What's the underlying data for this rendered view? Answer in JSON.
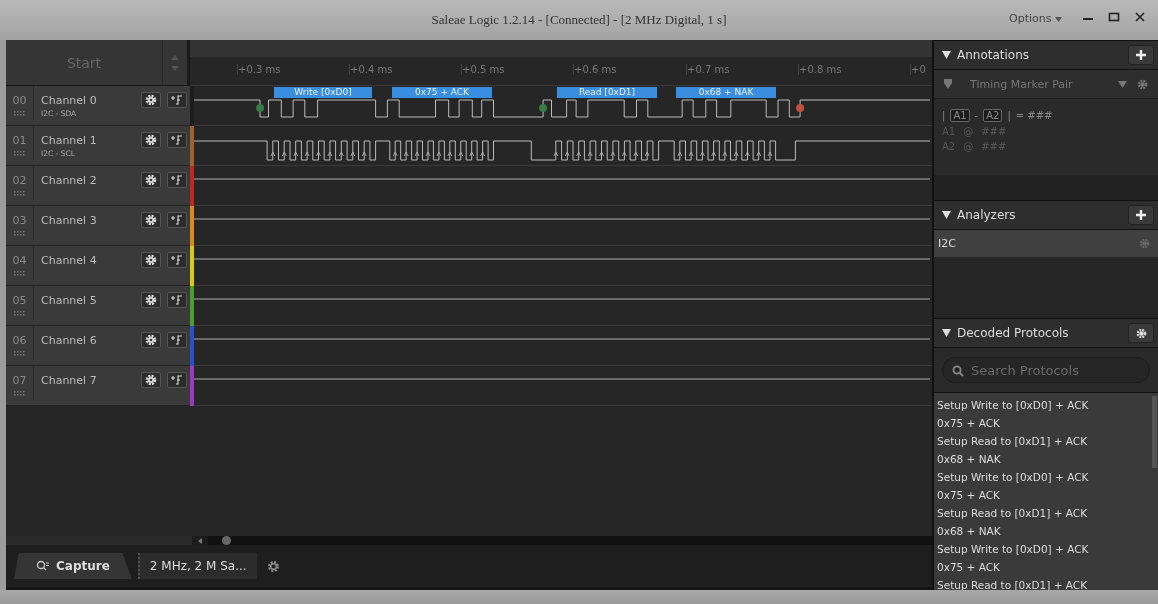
{
  "window": {
    "title": "Saleae Logic 1.2.14 - [Connected] - [2 MHz Digital, 1 s]",
    "options": "Options"
  },
  "start_button": "Start",
  "ruler": {
    "ticks": [
      "+0.3 ms",
      "+0.4 ms",
      "+0.5 ms",
      "+0.6 ms",
      "+0.7 ms",
      "+0.8 ms",
      "+0"
    ]
  },
  "channels": [
    {
      "number": "00",
      "name": "Channel 0",
      "label": "I2C - SDA",
      "color": "#1c1c1c",
      "kind": "sda",
      "decodes": [
        "Write [0xD0]",
        "0x75 + ACK",
        "Read [0xD1]",
        "0x68 + NAK"
      ]
    },
    {
      "number": "01",
      "name": "Channel 1",
      "label": "I2C - SCL",
      "color": "#a0622a",
      "kind": "scl"
    },
    {
      "number": "02",
      "name": "Channel 2",
      "color": "#c0281e",
      "kind": "idle"
    },
    {
      "number": "03",
      "name": "Channel 3",
      "color": "#d98a1a",
      "kind": "idle"
    },
    {
      "number": "04",
      "name": "Channel 4",
      "color": "#d8c81a",
      "kind": "idle"
    },
    {
      "number": "05",
      "name": "Channel 5",
      "color": "#4a9e2a",
      "kind": "idle"
    },
    {
      "number": "06",
      "name": "Channel 6",
      "color": "#2a50c8",
      "kind": "idle"
    },
    {
      "number": "07",
      "name": "Channel 7",
      "color": "#9a3ac0",
      "kind": "idle"
    }
  ],
  "tabs": {
    "capture": "Capture",
    "session": "2 MHz, 2 M Sa..."
  },
  "annotations": {
    "title": "Annotations",
    "marker": "Timing Marker Pair",
    "formula": [
      "|",
      "A1",
      "-",
      "A2",
      "|",
      "= ###"
    ],
    "rows": [
      [
        "A1",
        "@",
        "###"
      ],
      [
        "A2",
        "@",
        "###"
      ]
    ]
  },
  "analyzers": {
    "title": "Analyzers",
    "items": [
      {
        "name": "I2C",
        "selected": true
      }
    ]
  },
  "decoded": {
    "title": "Decoded Protocols",
    "placeholder": "Search Protocols",
    "rows": [
      "Setup Write to [0xD0] + ACK",
      "0x75 + ACK",
      "Setup Read to [0xD1] + ACK",
      "0x68 + NAK",
      "Setup Write to [0xD0] + ACK",
      "0x75 + ACK",
      "Setup Read to [0xD1] + ACK",
      "0x68 + NAK",
      "Setup Write to [0xD0] + ACK",
      "0x75 + ACK",
      "Setup Read to [0xD1] + ACK"
    ]
  }
}
